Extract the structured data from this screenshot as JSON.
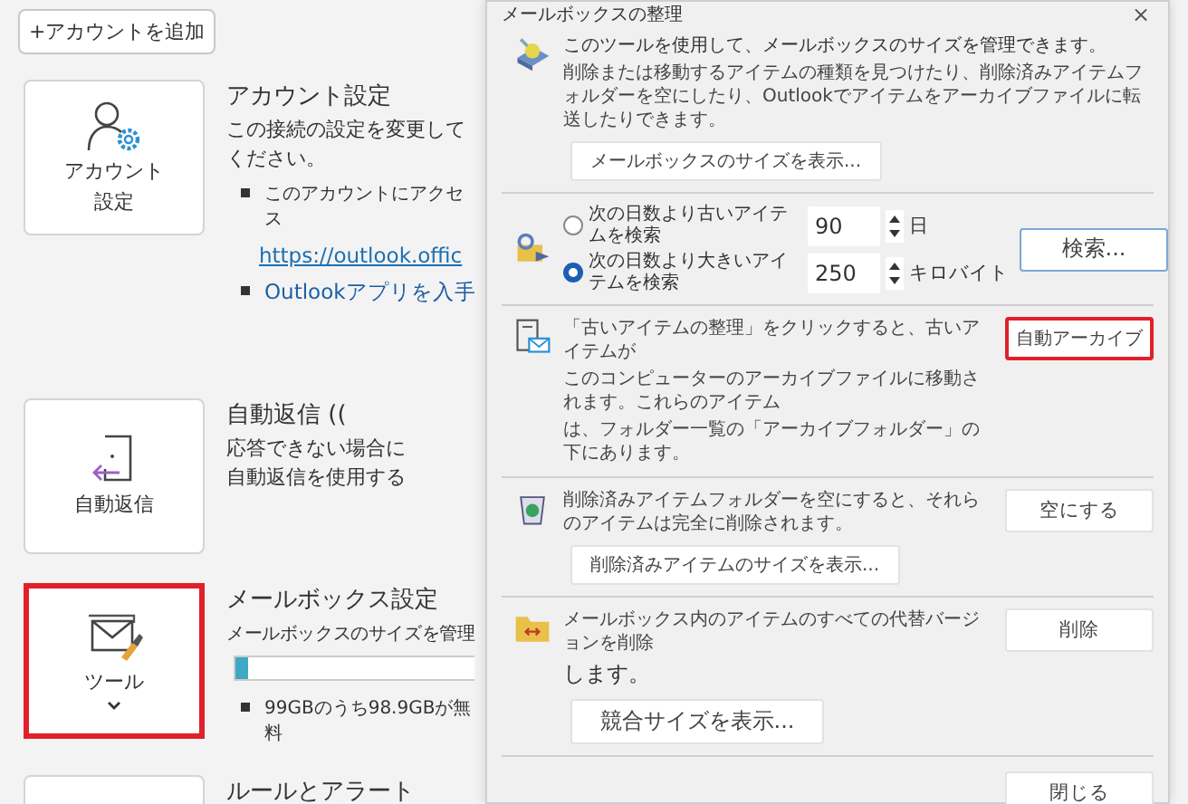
{
  "add_account_button": "+アカウントを追加",
  "sections": [
    {
      "kind": "account",
      "card_label": [
        "アカウント",
        "設定"
      ],
      "highlighted": false,
      "heading": "アカウント設定",
      "description": [
        "この接続の設定を変更して",
        "ください。"
      ],
      "items": [
        {
          "kind": "bullet",
          "text": "このアカウントにアクセス"
        },
        {
          "kind": "link",
          "text": "https://outlook.offic"
        },
        {
          "kind": "bullet-link",
          "text": "Outlookアプリを入手"
        }
      ]
    },
    {
      "kind": "autoreply",
      "card_label": [
        "自動返信"
      ],
      "highlighted": false,
      "heading": "自動返信 ((",
      "description": [
        "応答できない場合に",
        "自動返信を使用する"
      ]
    },
    {
      "kind": "tools",
      "card_label": [
        "ツール"
      ],
      "highlighted": true,
      "heading": "メールボックス設定",
      "note": "メールボックスのサイズを管理",
      "level": 0.05,
      "items": [
        {
          "kind": "bullet",
          "text": "99GBのうち98.9GBが無料"
        }
      ]
    },
    {
      "kind": "rules",
      "highlighted": false,
      "heading": "ルールとアラート"
    }
  ],
  "dialog": {
    "title": "メールボックスの整理",
    "close": "×",
    "intro": {
      "heading": "このツールを使用して、メールボックスのサイズを管理できます。",
      "body": "削除または移動するアイテムの種類を見つけたり、削除済みアイテムフォルダーを空にしたり、Outlookでアイテムをアーカイブファイルに転送したりできます。",
      "button": "メールボックスのサイズを表示..."
    },
    "search": {
      "options": [
        {
          "label": "次の日数より古いアイテムを検索",
          "value": "90",
          "unit": "日",
          "selected": false
        },
        {
          "label": "次の日数より大きいアイテムを検索",
          "value": "250",
          "unit": "キロバイト",
          "selected": true
        }
      ],
      "button": "検索..."
    },
    "archive": {
      "lines": [
        "「古いアイテムの整理」をクリックすると、古いアイテムが",
        "このコンピューターのアーカイブファイルに移動されます。これらのアイテム",
        "は、フォルダー一覧の「アーカイブフォルダー」の下にあります。"
      ],
      "button": "自動アーカイブ",
      "highlighted": true
    },
    "deleted": {
      "text": "削除済みアイテムフォルダーを空にすると、それらのアイテムは完全に削除されます。",
      "size_button": "削除済みアイテムのサイズを表示...",
      "button": "空にする"
    },
    "conflicts": {
      "lines": [
        "メールボックス内のアイテムのすべての代替バージョンを削除",
        "します。"
      ],
      "size_button": "競合サイズを表示...",
      "button": "削除"
    },
    "close_button": "閉じる"
  }
}
